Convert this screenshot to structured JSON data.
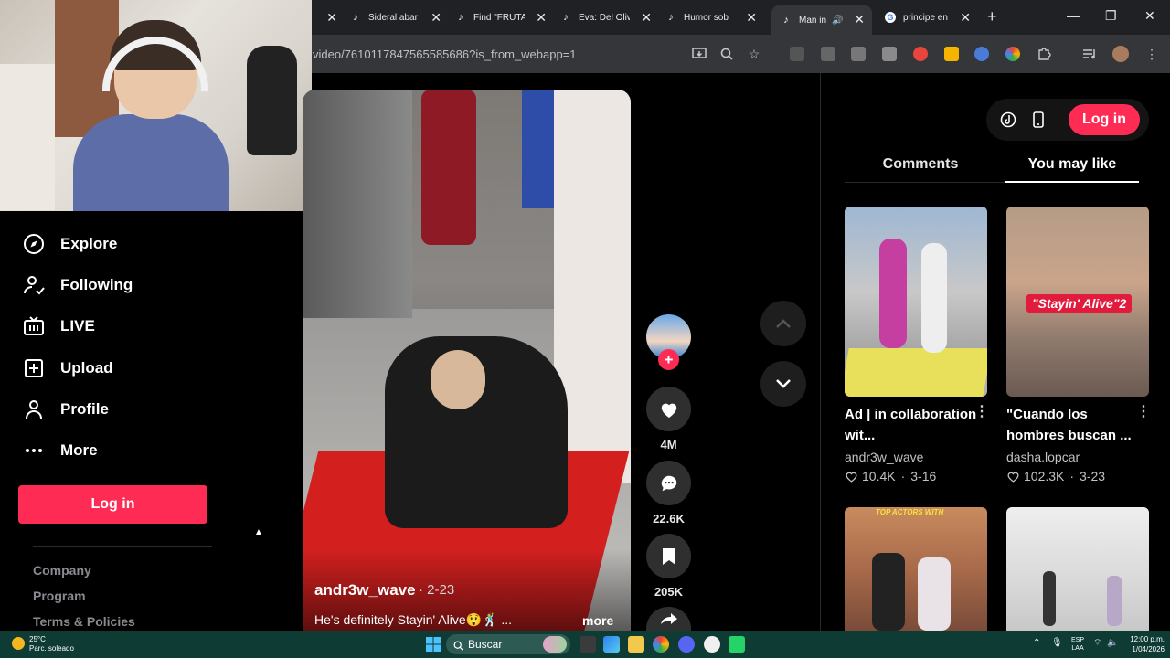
{
  "browser": {
    "tabs": [
      {
        "label": "",
        "icon": "unknown",
        "active": false
      },
      {
        "label": "Sideral abar",
        "icon": "tiktok",
        "active": false
      },
      {
        "label": "Find \"FRUTA",
        "icon": "tiktok",
        "active": false
      },
      {
        "label": "Eva: Del Oliv",
        "icon": "tiktok",
        "active": false
      },
      {
        "label": "Humor sob",
        "icon": "tiktok",
        "active": false
      },
      {
        "label": "Man in",
        "icon": "tiktok",
        "active": true
      },
      {
        "label": "principe en",
        "icon": "google",
        "active": false
      }
    ],
    "url": "video/7610117847565585686?is_from_webapp=1"
  },
  "sidebar": {
    "items": [
      {
        "label": "Explore",
        "icon": "compass-icon"
      },
      {
        "label": "Following",
        "icon": "following-icon"
      },
      {
        "label": "LIVE",
        "icon": "live-icon"
      },
      {
        "label": "Upload",
        "icon": "upload-icon"
      },
      {
        "label": "Profile",
        "icon": "profile-icon"
      },
      {
        "label": "More",
        "icon": "more-icon"
      }
    ],
    "login_label": "Log in",
    "footer_links": [
      "Company",
      "Program",
      "Terms & Policies"
    ]
  },
  "video": {
    "username": "andr3w_wave",
    "date": "· 2-23",
    "description": "He's definitely Stayin' Alive😲🕺 ...",
    "more_label": "more"
  },
  "actions": {
    "likes": "4M",
    "comments": "22.6K",
    "saves": "205K"
  },
  "right_panel": {
    "login_label": "Log in",
    "tabs": [
      "Comments",
      "You may like"
    ],
    "active_tab": "You may like",
    "cards": [
      {
        "title": "Ad | in collaboration wit...",
        "author": "andr3w_wave",
        "likes": "10.4K",
        "date": "3-16"
      },
      {
        "title": "\"Cuando los hombres buscan ...",
        "author": "dasha.lopcar",
        "likes": "102.3K",
        "date": "3-23",
        "overlay_text": "\"Stayin' Alive\"2"
      },
      {
        "overlay_text": "TOP ACTORS WITH"
      },
      {}
    ]
  },
  "taskbar": {
    "weather_temp": "25°C",
    "weather_desc": "Parc. soleado",
    "search_label": "Buscar",
    "lang_line1": "ESP",
    "lang_line2": "LAA",
    "time": "12:00 p.m.",
    "date": "1/04/2026"
  },
  "colors": {
    "accent": "#fe2c55",
    "taskbar": "#0f3b35",
    "chrome_dark": "#202124"
  }
}
